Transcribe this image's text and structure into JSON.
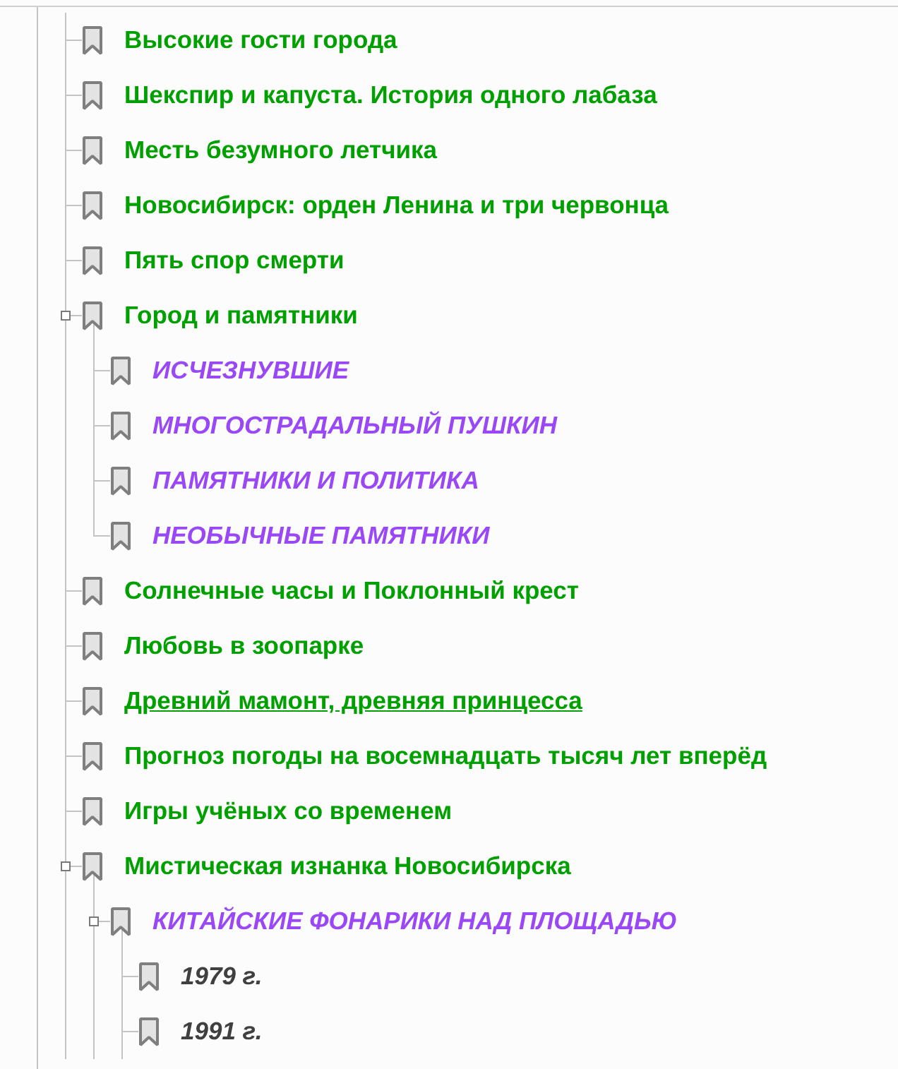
{
  "bookmarks": [
    {
      "title": "Высокие гости города",
      "color": "#00a000",
      "italic": false,
      "hovered": false
    },
    {
      "title": "Шекспир и капуста. История одного лабаза",
      "color": "#00a000",
      "italic": false,
      "hovered": false
    },
    {
      "title": "Месть безумного летчика",
      "color": "#00a000",
      "italic": false,
      "hovered": false
    },
    {
      "title": "Новосибирск: орден Ленина и три червонца",
      "color": "#00a000",
      "italic": false,
      "hovered": false
    },
    {
      "title": "Пять спор смерти",
      "color": "#00a000",
      "italic": false,
      "hovered": false
    },
    {
      "title": "Город и памятники",
      "color": "#00a000",
      "italic": false,
      "hovered": false,
      "expanded": true,
      "children": [
        {
          "title": "ИСЧЕЗНУВШИЕ",
          "color": "#9a48f5",
          "italic": true,
          "hovered": false
        },
        {
          "title": "МНОГОСТРАДАЛЬНЫЙ ПУШКИН",
          "color": "#9a48f5",
          "italic": true,
          "hovered": false
        },
        {
          "title": "ПАМЯТНИКИ И ПОЛИТИКА",
          "color": "#9a48f5",
          "italic": true,
          "hovered": false
        },
        {
          "title": "НЕОБЫЧНЫЕ ПАМЯТНИКИ",
          "color": "#9a48f5",
          "italic": true,
          "hovered": false
        }
      ]
    },
    {
      "title": "Солнечные часы и Поклонный крест",
      "color": "#00a000",
      "italic": false,
      "hovered": false
    },
    {
      "title": "Любовь в зоопарке",
      "color": "#00a000",
      "italic": false,
      "hovered": false
    },
    {
      "title": "Древний мамонт, древняя принцесса",
      "color": "#00a000",
      "italic": false,
      "hovered": true
    },
    {
      "title": "Прогноз погоды на восемнадцать тысяч лет вперёд",
      "color": "#00a000",
      "italic": false,
      "hovered": false
    },
    {
      "title": "Игры учёных со временем",
      "color": "#00a000",
      "italic": false,
      "hovered": false
    },
    {
      "title": "Мистическая изнанка Новосибирска",
      "color": "#00a000",
      "italic": false,
      "hovered": false,
      "expanded": true,
      "children": [
        {
          "title": "КИТАЙСКИЕ ФОНАРИКИ НАД ПЛОЩАДЬЮ",
          "color": "#9a48f5",
          "italic": true,
          "hovered": false,
          "expanded": true,
          "children": [
            {
              "title": "1979 г.",
              "color": "#404040",
              "italic": true,
              "hovered": false
            },
            {
              "title": "1991 г.",
              "color": "#404040",
              "italic": true,
              "hovered": false
            }
          ]
        }
      ]
    }
  ]
}
